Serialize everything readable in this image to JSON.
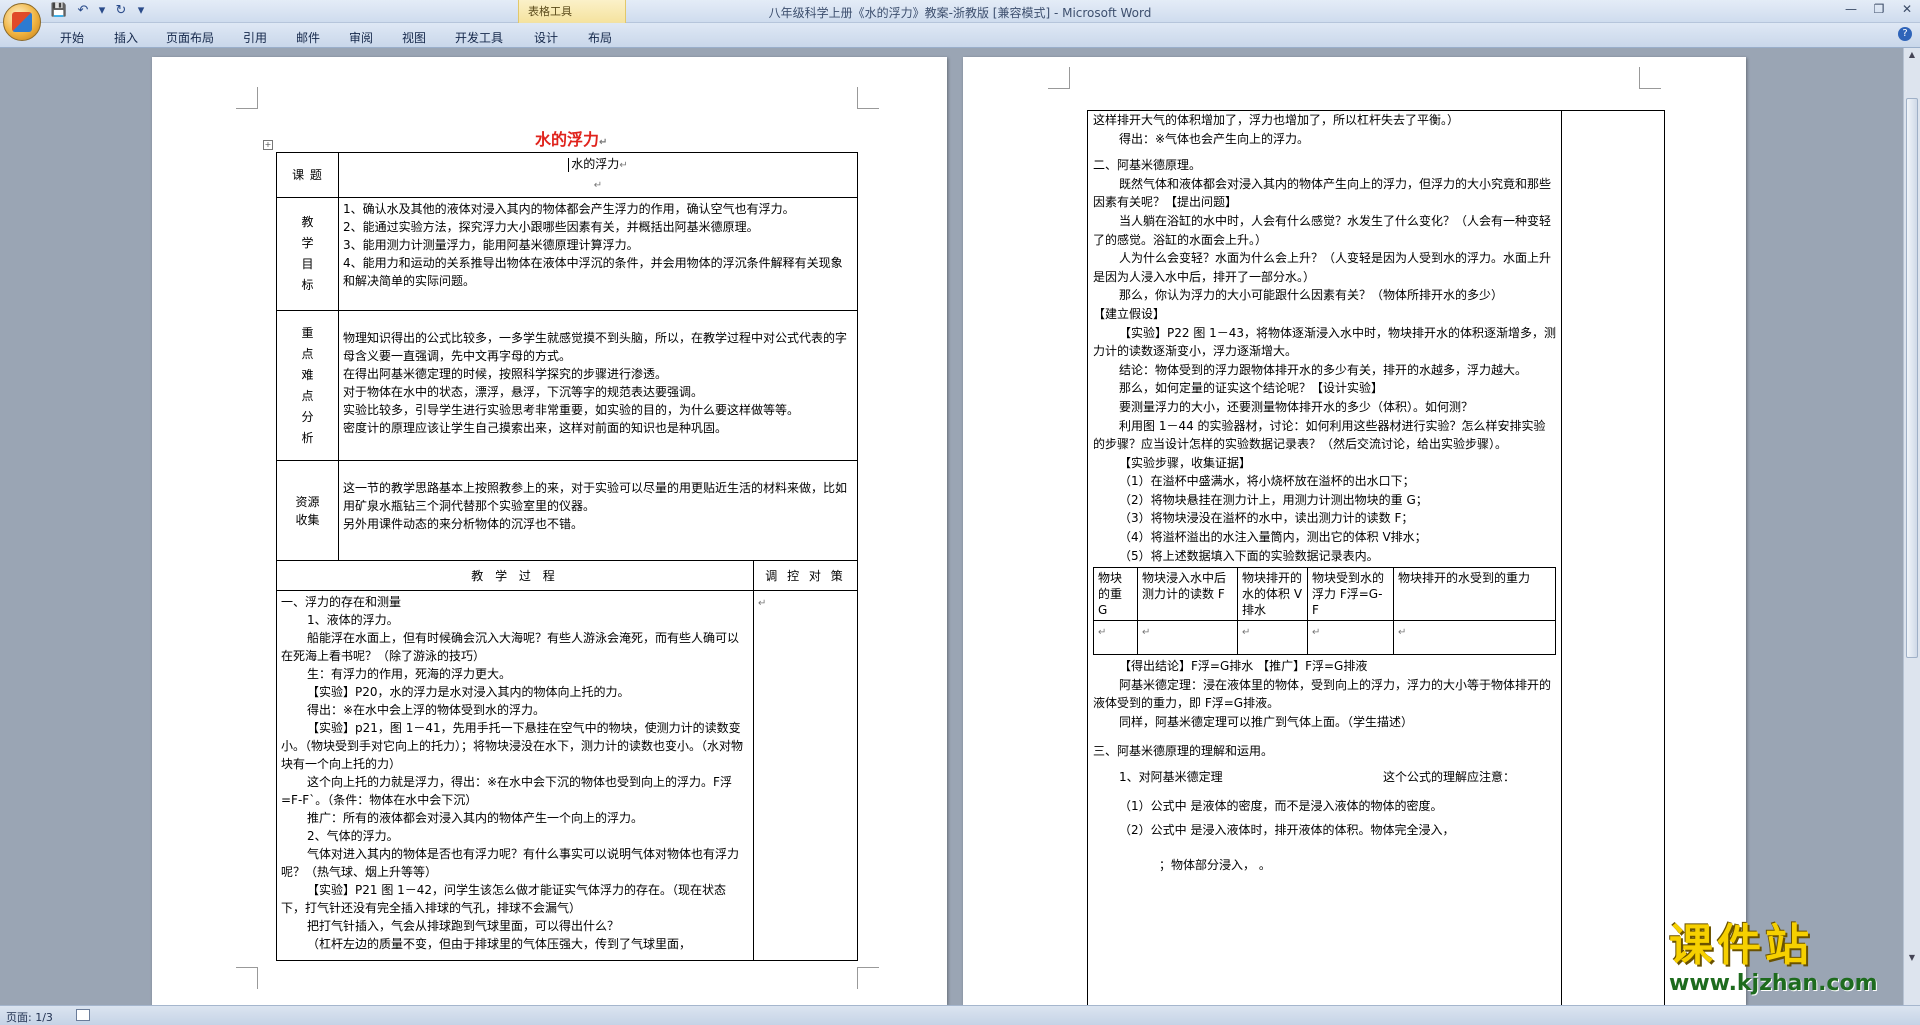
{
  "window": {
    "title": "八年级科学上册《水的浮力》教案-浙教版 [兼容模式] - Microsoft Word",
    "context_tab_group": "表格工具"
  },
  "ribbon": {
    "tabs": [
      "开始",
      "插入",
      "页面布局",
      "引用",
      "邮件",
      "审阅",
      "视图",
      "开发工具",
      "设计",
      "布局"
    ]
  },
  "icons": {
    "office_button": "office-logo-icon",
    "save": "save-icon",
    "undo": "undo-icon",
    "redo": "redo-icon",
    "customize": "chevron-down-icon",
    "minimize": "minimize-icon",
    "restore": "restore-icon",
    "close": "close-icon",
    "help": "help-icon"
  },
  "page1": {
    "title": "水的浮力",
    "topic_label": "课 题",
    "topic_value": "水的浮力",
    "goals_label": "教学目标",
    "goals": [
      "1、确认水及其他的液体对浸入其内的物体都会产生浮力的作用，确认空气也有浮力。",
      "2、能通过实验方法，探究浮力大小跟哪些因素有关，并概括出阿基米德原理。",
      "3、能用测力计测量浮力，能用阿基米德原理计算浮力。",
      "4、能用力和运动的关系推导出物体在液体中浮沉的条件，并会用物体的浮沉条件解释有关现象和解决简单的实际问题。"
    ],
    "key_label": "重点难点分析",
    "key_points": [
      "物理知识得出的公式比较多，一多学生就感觉摸不到头脑，所以，在教学过程中对公式代表的字母含义要一直强调，先中文再字母的方式。",
      "在得出阿基米德定理的时候，按照科学探究的步骤进行渗透。",
      "对于物体在水中的状态，漂浮，悬浮，下沉等字的规范表达要强调。",
      "实验比较多，引导学生进行实验思考非常重要，如实验的目的，为什么要这样做等等。",
      "密度计的原理应该让学生自己摸索出来，这样对前面的知识也是种巩固。"
    ],
    "resource_label": "资源收集",
    "resources": [
      "这一节的教学思路基本上按照教参上的来，对于实验可以尽量的用更贴近生活的材料来做，比如用矿泉水瓶钻三个洞代替那个实验室里的仪器。",
      "另外用课件动态的来分析物体的沉浮也不错。"
    ],
    "process_header": "教 学 过 程",
    "control_header": "调 控 对 策",
    "process": [
      "一、浮力的存在和测量",
      "1、液体的浮力。",
      "船能浮在水面上，但有时候确会沉入大海呢？有些人游泳会淹死，而有些人确可以在死海上看书呢？（除了游泳的技巧）",
      "生：有浮力的作用，死海的浮力更大。",
      "【实验】P20，水的浮力是水对浸入其内的物体向上托的力。",
      "得出：※在水中会上浮的物体受到水的浮力。",
      "【实验】p21，图 1－41，先用手托一下悬挂在空气中的物块，使测力计的读数变小。（物块受到手对它向上的托力）；将物块浸没在水下，测力计的读数也变小。（水对物块有一个向上托的力）",
      "这个向上托的力就是浮力，得出：※在水中会下沉的物体也受到向上的浮力。F浮=F-F`。（条件：物体在水中会下沉）",
      "推广：所有的液体都会对浸入其内的物体产生一个向上的浮力。",
      "2、气体的浮力。",
      "气体对进入其内的物体是否也有浮力呢？有什么事实可以说明气体对物体也有浮力呢？（热气球、烟上升等等）",
      "【实验】P21 图 1－42，问学生该怎么做才能证实气体浮力的存在。（现在状态下，打气针还没有完全插入排球的气孔，排球不会漏气）",
      "把打气针插入，气会从排球跑到气球里面，可以得出什么？",
      "（杠杆左边的质量不变，但由于排球里的气体压强大，传到了气球里面，"
    ]
  },
  "page2": {
    "lines_a": [
      "这样排开大气的体积增加了，浮力也增加了，所以杠杆失去了平衡。）",
      "得出：※气体也会产生向上的浮力。"
    ],
    "section2_title": "二、阿基米德原理。",
    "lines_b": [
      "既然气体和液体都会对浸入其内的物体产生向上的浮力，但浮力的大小究竟和那些因素有关呢？【提出问题】",
      "当人躺在浴缸的水中时，人会有什么感觉？水发生了什么变化？（人会有一种变轻了的感觉。浴缸的水面会上升。）",
      "人为什么会变轻？水面为什么会上升？（人变轻是因为人受到水的浮力。水面上升是因为人浸入水中后，排开了一部分水。）",
      "那么，你认为浮力的大小可能跟什么因素有关？（物体所排开水的多少）"
    ],
    "hypothesis": "【建立假设】",
    "lines_c": [
      "【实验】P22 图 1－43，将物体逐渐浸入水中时，物块排开水的体积逐渐增多，测力计的读数逐渐变小，浮力逐渐增大。",
      "结论：物体受到的浮力跟物体排开水的多少有关，排开的水越多，浮力越大。",
      "那么，如何定量的证实这个结论呢？【设计实验】",
      "要测量浮力的大小，还要测量物体排开水的多少（体积）。如何测？",
      "利用图 1－44 的实验器材，讨论：如何利用这些器材进行实验？怎么样安排实验的步骤？应当设计怎样的实验数据记录表？（然后交流讨论，给出实验步骤）。",
      "【实验步骤，收集证据】"
    ],
    "steps": [
      "（1）在溢杯中盛满水，将小烧杯放在溢杯的出水口下；",
      "（2）将物块悬挂在测力计上，用测力计测出物块的重 G；",
      "（3）将物块浸没在溢杯的水中，读出测力计的读数 F；",
      "（4）将溢杯溢出的水注入量筒内，测出它的体积 V排水；",
      "（5）将上述数据填入下面的实验数据记录表内。"
    ],
    "table_headers": [
      "物块的重 G",
      "物块浸入水中后测力计的读数 F",
      "物块排开的水的体积 V排水",
      "物块受到水的浮力 F浮=G-F",
      "物块排开的水受到的重力"
    ],
    "conclusion": "【得出结论】F浮=G排水  【推广】F浮=G排液",
    "lines_d": [
      "阿基米德定理：浸在液体里的物体，受到向上的浮力，浮力的大小等于物体排开的液体受到的重力，即 F浮=G排液。",
      "同样，阿基米德定理可以推广到气体上面。（学生描述）"
    ],
    "section3_title": "三、阿基米德原理的理解和运用。",
    "understand_left": "1、对阿基米德定理",
    "understand_right": "这个公式的理解应注意：",
    "note1": "（1）公式中     是液体的密度，而不是浸入液体的物体的密度。",
    "note2": "（2）公式中     是浸入液体时，排开液体的体积。物体完全浸入，",
    "note3": "；物体部分浸入，           。"
  },
  "status": {
    "page": "页面: 1/3"
  },
  "watermark": {
    "big": "课件站",
    "url": "www.kjzhan.com"
  }
}
